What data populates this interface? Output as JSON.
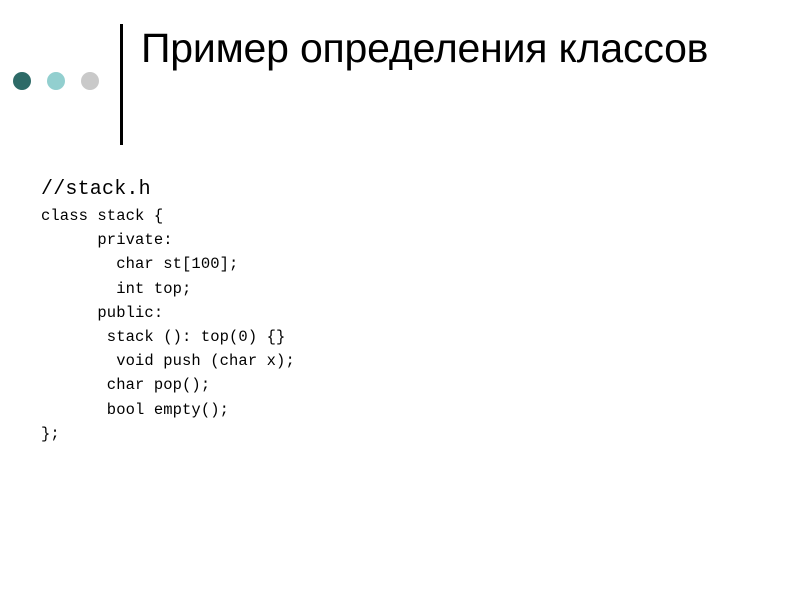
{
  "slide": {
    "background_color": "#ffffff",
    "text_color": "#000000",
    "title": "Пример определения классов",
    "title_line_1": "Пример определения",
    "title_line_2": "классов",
    "decor": {
      "rule_color": "#000000",
      "dots": [
        {
          "name": "dot-dark-teal",
          "color": "#2d6a67"
        },
        {
          "name": "dot-light-teal",
          "color": "#92cfcf"
        },
        {
          "name": "dot-gray",
          "color": "#c9c9c9"
        }
      ]
    },
    "code": {
      "language": "cpp",
      "file_comment": "//stack.h",
      "lines": [
        "//stack.h",
        "class stack {",
        "      private:",
        "        char st[100];",
        "        int top;",
        "      public:",
        "       stack (): top(0) {}",
        "        void push (char x);",
        "       char pop();",
        "       bool empty();",
        "};"
      ]
    }
  }
}
